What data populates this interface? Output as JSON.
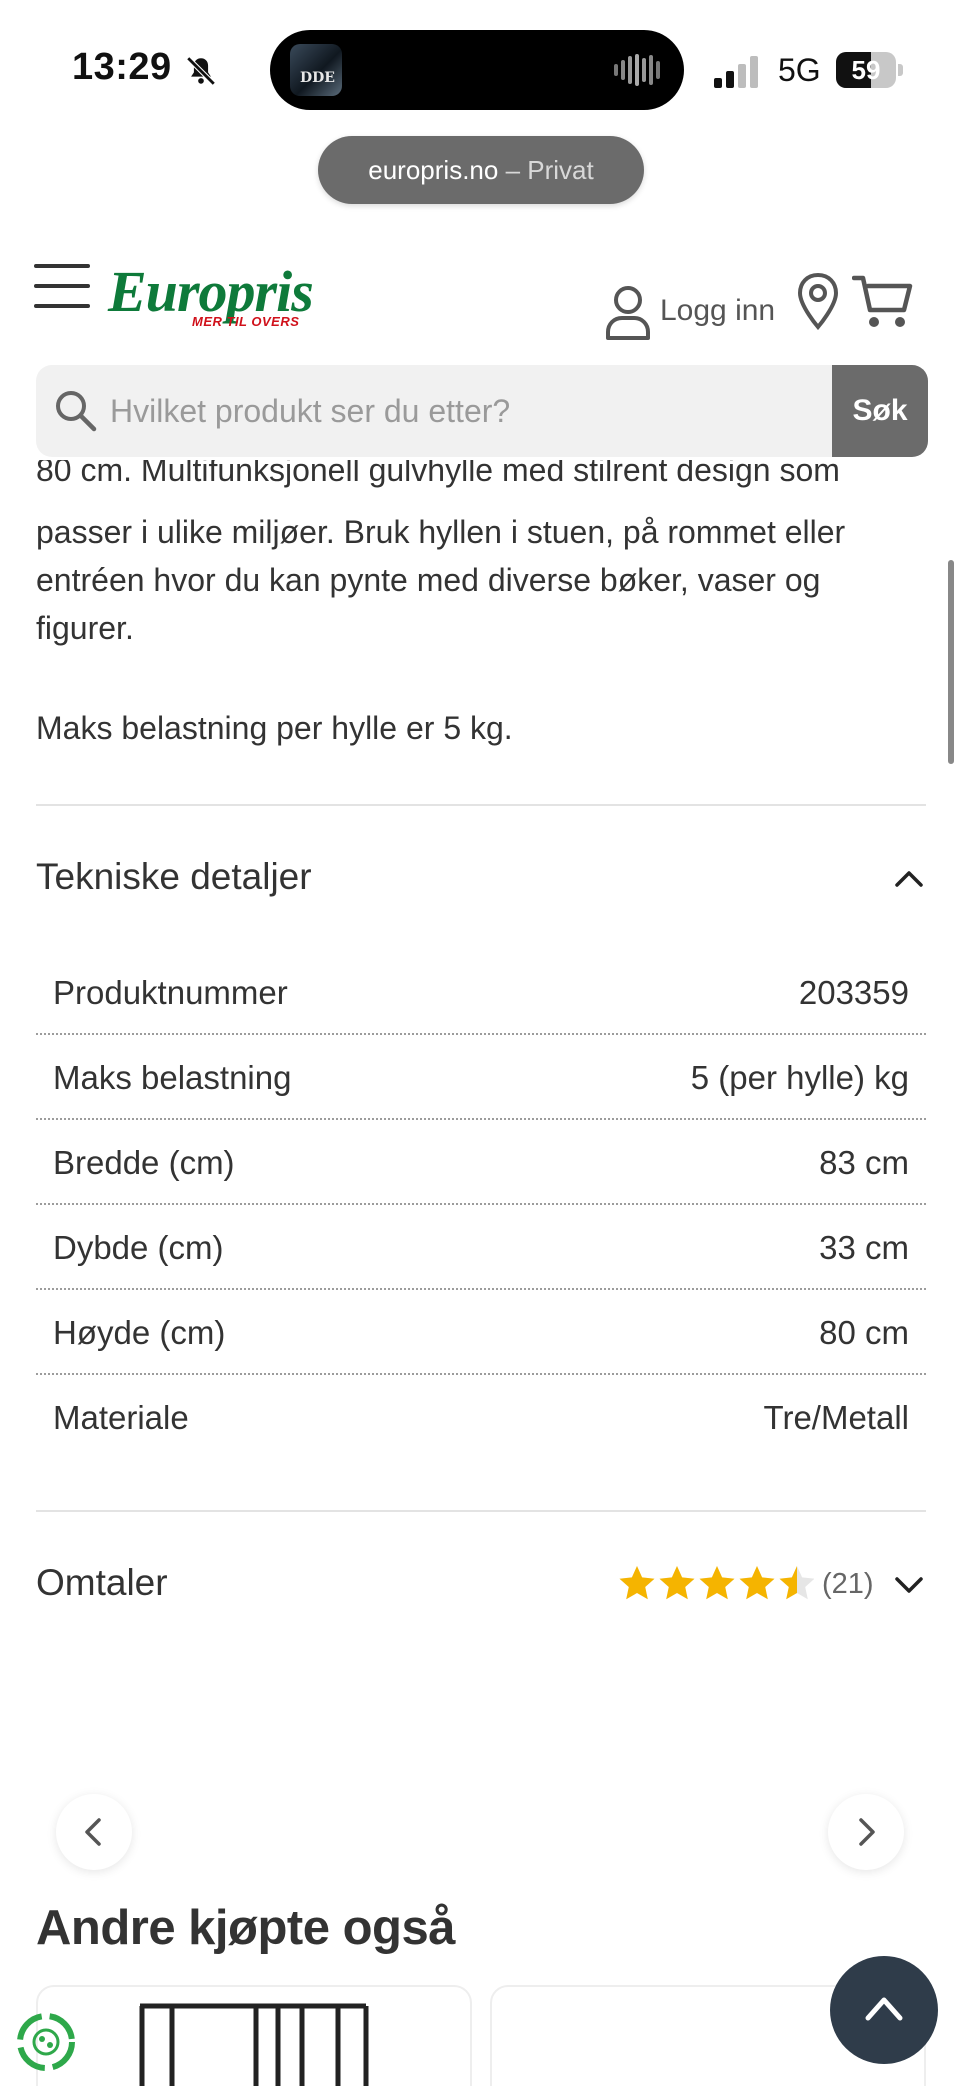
{
  "status_bar": {
    "time": "13:29",
    "network": "5G",
    "battery_level": 59,
    "battery_text": "59",
    "now_playing_art_text": "DDE"
  },
  "browser": {
    "domain": "europris.no",
    "mode_separator": " – ",
    "mode": "Privat"
  },
  "header": {
    "logo_text": "Europris",
    "logo_tagline": "MER TIL OVERS",
    "login_label": "Logg inn",
    "brand_color": "#0e7a3a",
    "accent_color": "#d0101a"
  },
  "search": {
    "placeholder": "Hvilket produkt ser du etter?",
    "button_label": "Søk"
  },
  "description": {
    "partial_line": "80 cm. Multifunksjonell gulvhylle med stilrent design som",
    "paragraph": "passer i ulike miljøer. Bruk hyllen i stuen, på rommet eller entréen hvor du kan pynte med diverse bøker, vaser og figurer.",
    "max_load": "Maks belastning per hylle er 5 kg."
  },
  "technical_details": {
    "title": "Tekniske detaljer",
    "expanded": true,
    "rows": [
      {
        "label": "Produktnummer",
        "value": "203359"
      },
      {
        "label": "Maks belastning",
        "value": "5 (per hylle) kg"
      },
      {
        "label": "Bredde (cm)",
        "value": "83 cm"
      },
      {
        "label": "Dybde (cm)",
        "value": "33 cm"
      },
      {
        "label": "Høyde (cm)",
        "value": "80 cm"
      },
      {
        "label": "Materiale",
        "value": "Tre/Metall"
      }
    ]
  },
  "reviews": {
    "title": "Omtaler",
    "rating": 4.5,
    "max_rating": 5,
    "count_text": "(21)",
    "star_color": "#f5b400"
  },
  "also_bought": {
    "title": "Andre kjøpte også"
  },
  "icons": {
    "menu": "hamburger-menu-icon",
    "user": "user-icon",
    "location": "location-pin-icon",
    "cart": "cart-icon",
    "search": "search-icon",
    "collapse": "chevron-up-icon",
    "expand": "chevron-down-icon",
    "prev": "chevron-left-icon",
    "next": "chevron-right-icon",
    "scroll_top": "arrow-up-icon",
    "eco": "recycle-icon"
  }
}
